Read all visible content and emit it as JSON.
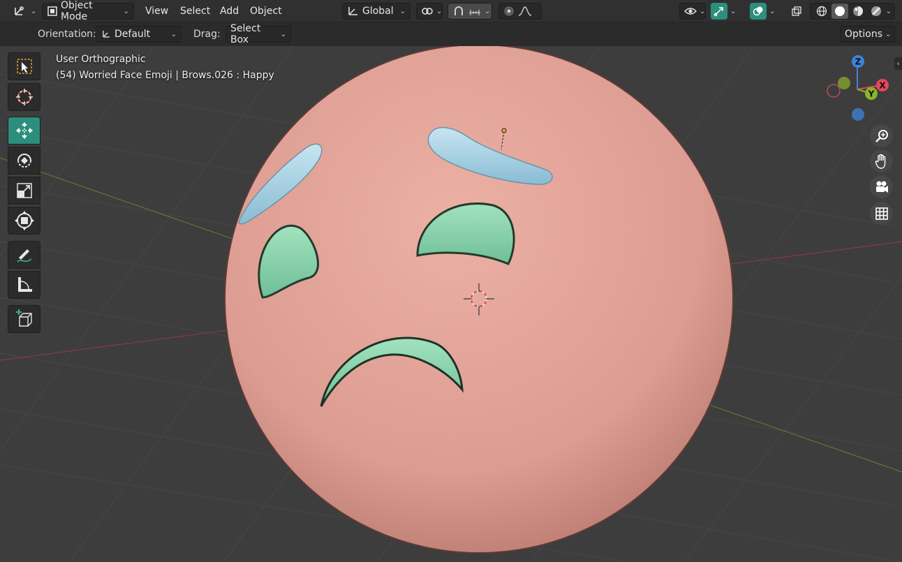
{
  "header": {
    "editor_type_icon": "view3d-icon",
    "mode": {
      "icon": "object-mode-icon",
      "label": "Object Mode"
    },
    "menus": [
      "View",
      "Select",
      "Add",
      "Object"
    ],
    "transform_orientation": {
      "icon": "orientation-icon",
      "label": "Global"
    },
    "pivot_icon": "pivot-point-icon",
    "snap_icon": "snap-magnet-icon",
    "snap_target_icon": "snap-increment-icon",
    "proportional_icon": "proportional-edit-icon",
    "falloff_icon": "falloff-curve-icon",
    "visibility_icon": "eye-icon",
    "gizmo_icon": "gizmo-icon",
    "overlay_icon": "overlay-icon",
    "xray_icon": "xray-icon",
    "shading_modes": [
      "wireframe",
      "solid",
      "material-preview",
      "rendered"
    ]
  },
  "tool_settings": {
    "orientation_label": "Orientation:",
    "orientation_value": "Default",
    "drag_label": "Drag:",
    "drag_value": "Select Box",
    "options_label": "Options"
  },
  "viewport": {
    "view_name": "User Orthographic",
    "object_info": "(54) Worried Face Emoji | Brows.026 : Happy"
  },
  "toolbar": [
    "select-box",
    "cursor",
    "move",
    "rotate",
    "scale",
    "transform",
    "annotate",
    "measure",
    "add-cube"
  ],
  "nav_gizmo": {
    "axes": [
      "Z",
      "X",
      "Y"
    ]
  },
  "navigation": [
    "zoom-icon",
    "pan-hand-icon",
    "camera-icon",
    "grid-ortho-icon"
  ],
  "colors": {
    "accent": "#2c8f7d",
    "face": "#e4a398",
    "brow": "#a9d3e6",
    "eye": "#8ed3ad",
    "axis_x": "#e5485a",
    "axis_y": "#8ab42b",
    "axis_z": "#3f84d9"
  }
}
